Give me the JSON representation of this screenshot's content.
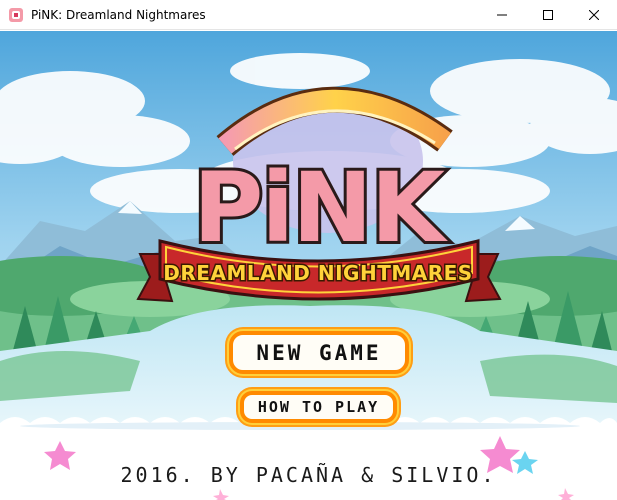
{
  "window": {
    "title": "PiNK: Dreamland Nightmares",
    "controls": [
      "minimize-icon",
      "maximize-icon",
      "close-icon"
    ]
  },
  "logo": {
    "title": "PiNK",
    "subtitle": "DREAMLAND NIGHTMARES"
  },
  "menu": {
    "new_game": "NEW GAME",
    "how_to_play": "HOW TO PLAY"
  },
  "footer": {
    "credits": "2016. BY PACAÑA & SILVIO."
  },
  "colors": {
    "sky": "#a8d8f0",
    "logo_pink": "#f49aa8",
    "banner_red": "#c8282a",
    "banner_gold": "#ffd23a",
    "button_orange": "#ff8a00"
  }
}
